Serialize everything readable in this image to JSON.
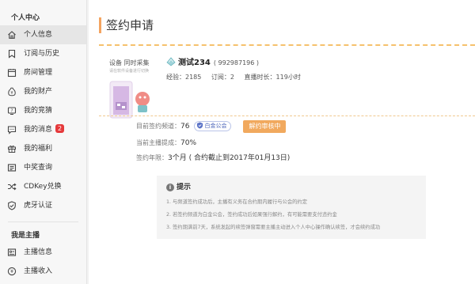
{
  "sidebar": {
    "section1_title": "个人中心",
    "items": [
      {
        "label": "个人信息",
        "icon": "home-icon"
      },
      {
        "label": "订阅与历史",
        "icon": "bookmark-icon"
      },
      {
        "label": "房间管理",
        "icon": "room-icon"
      },
      {
        "label": "我的财产",
        "icon": "money-bag-icon"
      },
      {
        "label": "我的竞猜",
        "icon": "quiz-icon"
      },
      {
        "label": "我的消息",
        "icon": "message-icon",
        "badge": "2"
      },
      {
        "label": "我的福利",
        "icon": "gift-icon"
      },
      {
        "label": "中奖查询",
        "icon": "ticket-icon"
      },
      {
        "label": "CDKey兑换",
        "icon": "shuffle-icon"
      },
      {
        "label": "虎牙认证",
        "icon": "shield-check-icon"
      }
    ],
    "section2_title": "我是主播",
    "items2": [
      {
        "label": "主播信息",
        "icon": "anchor-info-icon"
      },
      {
        "label": "主播收入",
        "icon": "income-icon"
      }
    ]
  },
  "main": {
    "title": "签约申请",
    "device": {
      "title": "设备 同时采集",
      "subtitle": "请在软件设备进行切换"
    },
    "streamer": {
      "name": "测试234",
      "id": "( 992987196 )",
      "exp": "经验：2185",
      "subs": "订阅：2",
      "duration": "直播时长：119小时"
    },
    "contract": {
      "channel_label": "目前签约频道：",
      "channel_value": "76",
      "guild_badge": "白金公会",
      "review_button": "解约审核中",
      "share_label": "当前主播提成：",
      "share_value": "70%",
      "term_label": "签约年限：",
      "term_value": "3个月 ( 合约截止到2017年01月13日)"
    },
    "tips": {
      "icon": "i",
      "title": "提示",
      "items": [
        "1. 与频道签约成功后，主播有义务在合约期内履行与公会的约定",
        "2. 若签约频道为白金公会，签约成功后如果强行解约，有可能需要支付违约金",
        "3. 签约期满前7天，系统发起的续签弹窗需要主播主动进入个人中心操作确认续签，才会续约成功"
      ]
    }
  },
  "colors": {
    "accent_orange": "#f1a95e",
    "badge_red": "#e5393b",
    "title_bar": "#f4a460",
    "guild_blue": "#4b64b8"
  }
}
